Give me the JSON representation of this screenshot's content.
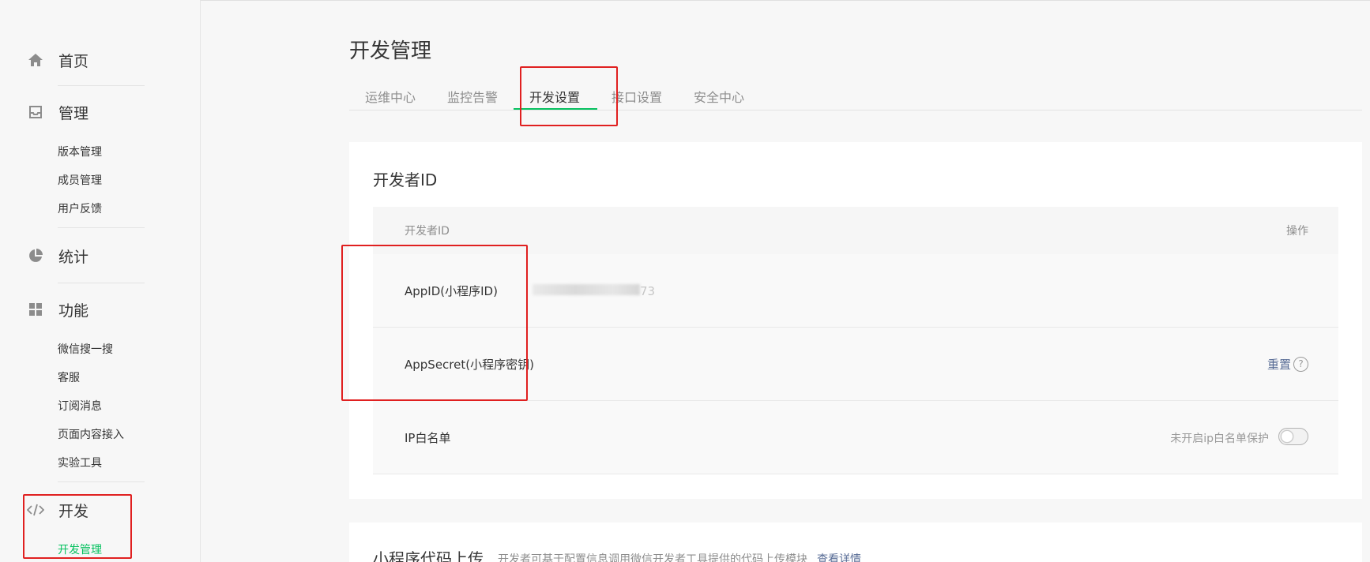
{
  "sidebar": {
    "home": {
      "label": "首页",
      "icon": "home-icon"
    },
    "manage": {
      "label": "管理",
      "icon": "inbox-icon",
      "items": [
        "版本管理",
        "成员管理",
        "用户反馈"
      ]
    },
    "stats": {
      "label": "统计",
      "icon": "pie-chart-icon"
    },
    "features": {
      "label": "功能",
      "icon": "grid-icon",
      "items": [
        "微信搜一搜",
        "客服",
        "订阅消息",
        "页面内容接入",
        "实验工具"
      ]
    },
    "dev": {
      "label": "开发",
      "icon": "code-icon",
      "items": [
        "开发管理"
      ],
      "active_item": "开发管理"
    }
  },
  "main": {
    "title": "开发管理",
    "tabs": [
      "运维中心",
      "监控告警",
      "开发设置",
      "接口设置",
      "安全中心"
    ],
    "active_tab": "开发设置",
    "developer_card": {
      "title": "开发者ID",
      "table_header": {
        "col1": "开发者ID",
        "col2": "操作"
      },
      "rows": {
        "appid": {
          "label": "AppID(小程序ID)",
          "value_suffix": "73"
        },
        "appsecret": {
          "label": "AppSecret(小程序密钥)",
          "action": "重置",
          "help": "?"
        },
        "ip_whitelist": {
          "label": "IP白名单",
          "status_text": "未开启ip白名单保护",
          "toggle_on": false
        }
      }
    },
    "upload_card": {
      "title": "小程序代码上传",
      "description": "开发者可基于配置信息调用微信开发者工具提供的代码上传模块",
      "link": "查看详情"
    }
  },
  "colors": {
    "accent_green": "#07c160",
    "link_blue": "#576b95",
    "annotation_red": "#e02020"
  }
}
